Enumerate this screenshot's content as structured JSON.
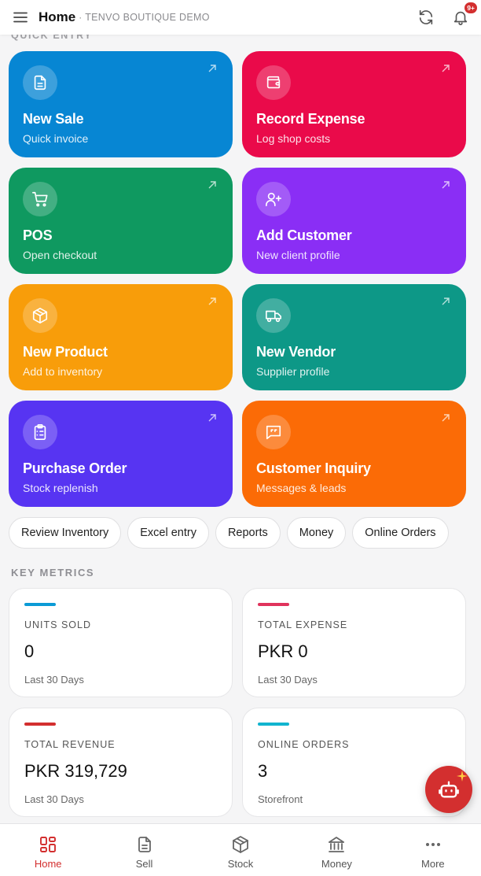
{
  "header": {
    "title": "Home",
    "separator": "·",
    "subtitle": "TENVO BOUTIQUE DEMO",
    "notification_badge": "9+",
    "icons": [
      "menu-icon",
      "refresh-icon",
      "bell-icon"
    ]
  },
  "quick_entry": {
    "label": "QUICK ENTRY",
    "tiles": [
      {
        "title": "New Sale",
        "subtitle": "Quick invoice",
        "color": "#0786d3",
        "icon": "document-icon"
      },
      {
        "title": "Record Expense",
        "subtitle": "Log shop costs",
        "color": "#ea0a4a",
        "icon": "wallet-icon"
      },
      {
        "title": "POS",
        "subtitle": "Open checkout",
        "color": "#0f9960",
        "icon": "cart-icon"
      },
      {
        "title": "Add Customer",
        "subtitle": "New client profile",
        "color": "#8a2ef5",
        "icon": "user-plus-icon"
      },
      {
        "title": "New Product",
        "subtitle": "Add to inventory",
        "color": "#f89d0a",
        "icon": "box-icon"
      },
      {
        "title": "New Vendor",
        "subtitle": "Supplier profile",
        "color": "#0d9887",
        "icon": "truck-icon"
      },
      {
        "title": "Purchase Order",
        "subtitle": "Stock replenish",
        "color": "#5734f2",
        "icon": "clipboard-icon"
      },
      {
        "title": "Customer Inquiry",
        "subtitle": "Messages & leads",
        "color": "#fb6b06",
        "icon": "message-quote-icon"
      }
    ]
  },
  "chips": [
    "Review Inventory",
    "Excel entry",
    "Reports",
    "Money",
    "Online Orders"
  ],
  "key_metrics": {
    "label": "KEY METRICS",
    "cards": [
      {
        "name": "UNITS SOLD",
        "value": "0",
        "footer": "Last 30 Days",
        "accent": "#0b9bd6"
      },
      {
        "name": "TOTAL EXPENSE",
        "value": "PKR 0",
        "footer": "Last 30 Days",
        "accent": "#e0335c"
      },
      {
        "name": "TOTAL REVENUE",
        "value": "PKR 319,729",
        "footer": "Last 30 Days",
        "accent": "#d32f2f"
      },
      {
        "name": "ONLINE ORDERS",
        "value": "3",
        "footer": "Storefront",
        "accent": "#11b4cf"
      }
    ]
  },
  "fab": {
    "icon": "robot-assistant-icon",
    "color": "#d32f2f"
  },
  "bottom_nav": [
    {
      "label": "Home",
      "icon": "grid-icon",
      "active": true
    },
    {
      "label": "Sell",
      "icon": "receipt-icon",
      "active": false
    },
    {
      "label": "Stock",
      "icon": "box-icon",
      "active": false
    },
    {
      "label": "Money",
      "icon": "bank-icon",
      "active": false
    },
    {
      "label": "More",
      "icon": "more-dots-icon",
      "active": false
    }
  ],
  "colors": {
    "accent": "#d32f2f",
    "background": "#f5f5f6"
  }
}
